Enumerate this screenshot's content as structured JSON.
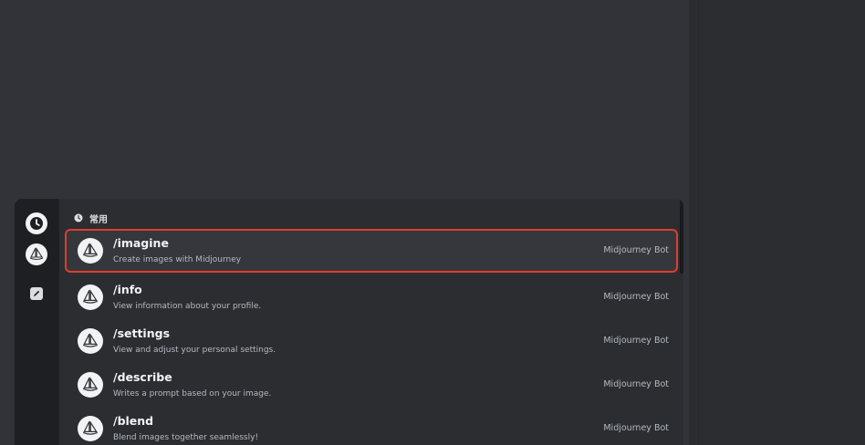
{
  "autocomplete": {
    "section_title": "常用",
    "commands": [
      {
        "name": "/imagine",
        "description": "Create images with Midjourney",
        "bot": "Midjourney Bot",
        "selected": true
      },
      {
        "name": "/info",
        "description": "View information about your profile.",
        "bot": "Midjourney Bot",
        "selected": false
      },
      {
        "name": "/settings",
        "description": "View and adjust your personal settings.",
        "bot": "Midjourney Bot",
        "selected": false
      },
      {
        "name": "/describe",
        "description": "Writes a prompt based on your image.",
        "bot": "Midjourney Bot",
        "selected": false
      },
      {
        "name": "/blend",
        "description": "Blend images together seamlessly!",
        "bot": "Midjourney Bot",
        "selected": false
      }
    ]
  },
  "rail": {
    "icons": [
      "clock-icon",
      "midjourney-boat-icon",
      "pencil-icon"
    ]
  },
  "colors": {
    "background": "#313338",
    "popup": "#2b2d31",
    "rail": "#1e1f22",
    "selection_outline": "#e03e2d",
    "text_primary": "#f2f3f5",
    "text_secondary": "#b5bac1"
  }
}
